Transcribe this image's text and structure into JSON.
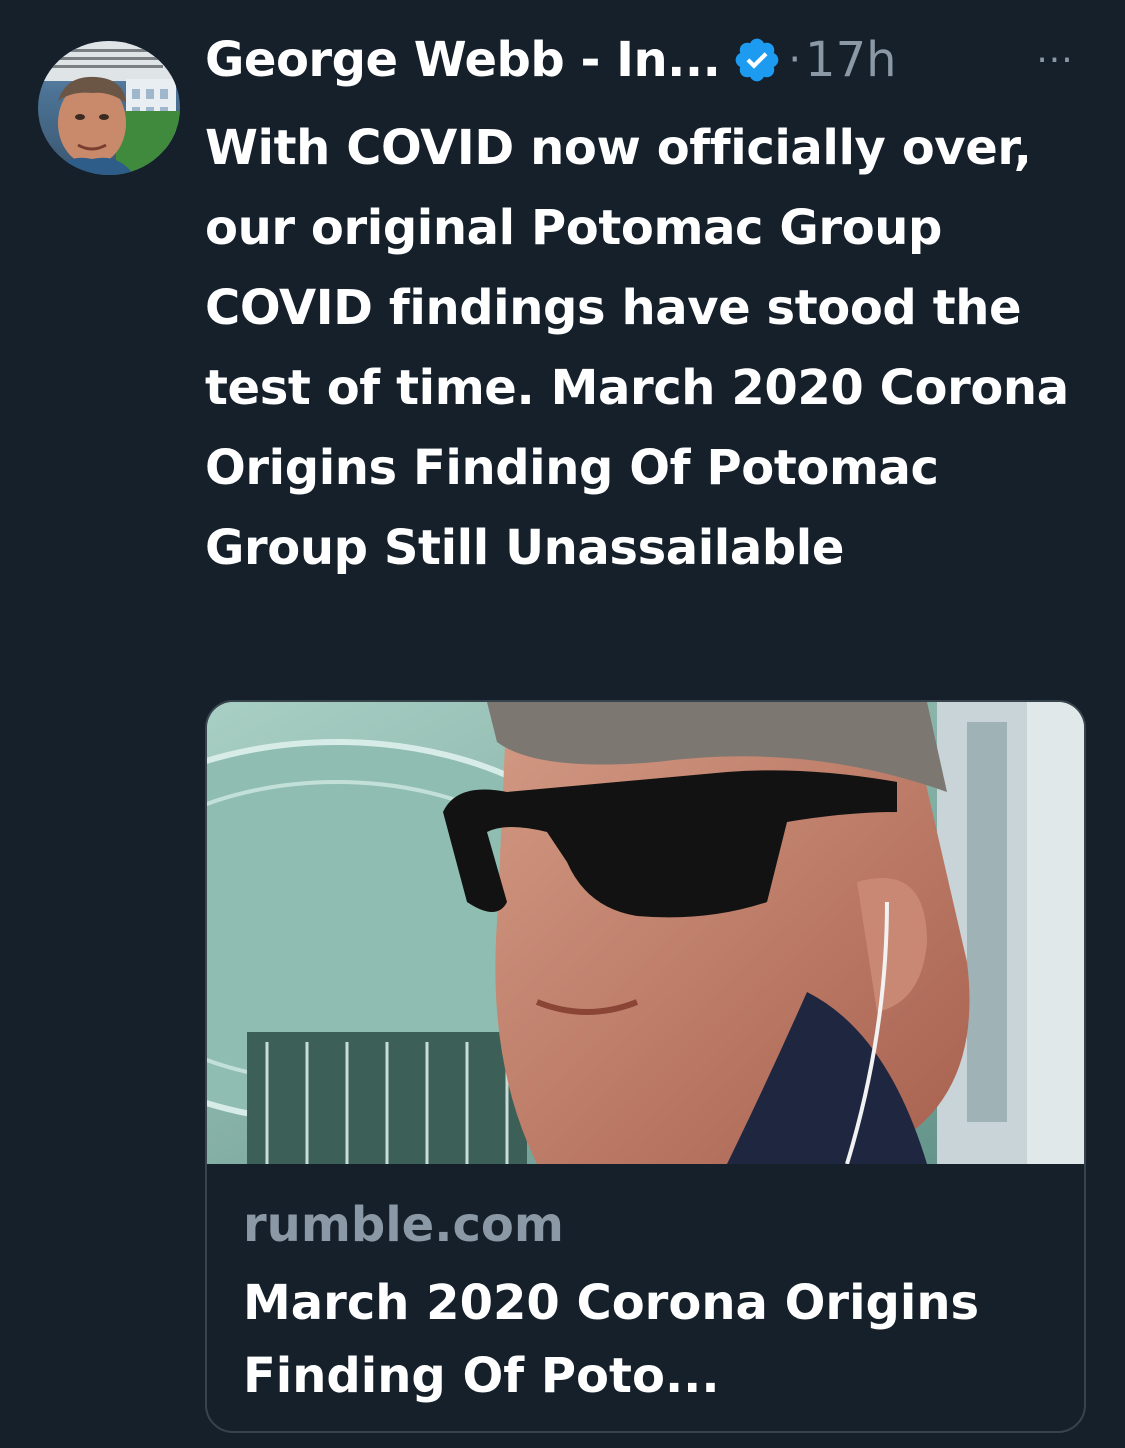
{
  "author": {
    "name": "George Webb - In...",
    "verified": true,
    "timestamp": "17h",
    "separator": "·"
  },
  "tweet": {
    "text": "With COVID now officially over, our original Potomac Group COVID findings have stood the test of time. March 2020 Corona Origins Finding Of Potomac Group Still Unassailable"
  },
  "card": {
    "domain": "rumble.com",
    "title": "March 2020 Corona Origins Finding Of Poto..."
  },
  "actions": {
    "more_label": "···"
  },
  "colors": {
    "background": "#15202b",
    "text": "#ffffff",
    "secondary_text": "#8b98a5",
    "verified_blue": "#1d9bf0",
    "card_border": "#38444d"
  },
  "icons": {
    "verified": "verified-badge-icon",
    "more": "more-options-icon"
  }
}
